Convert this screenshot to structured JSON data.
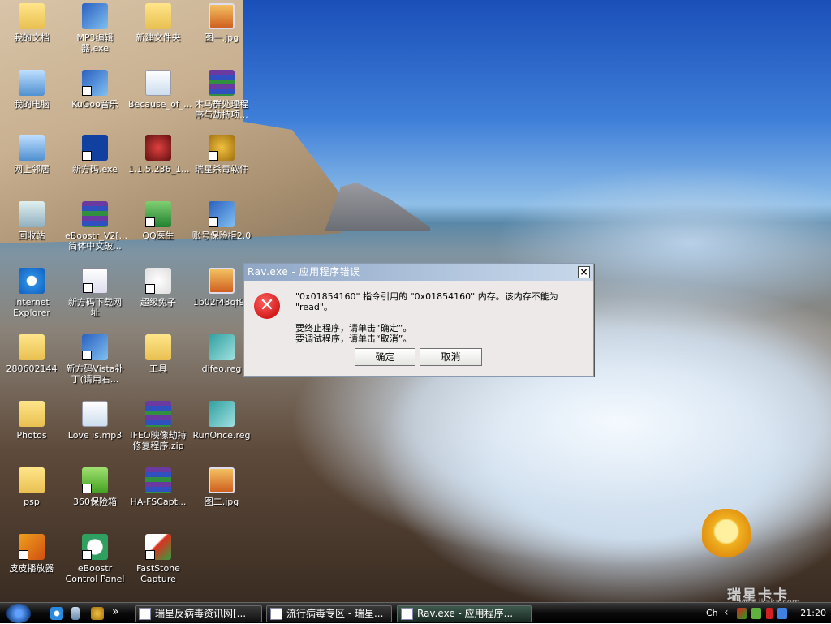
{
  "desktop": {
    "icons": [
      {
        "label": "我的文档",
        "kind": "folder"
      },
      {
        "label": "MP3编辑器.exe",
        "kind": "app"
      },
      {
        "label": "新建文件夹",
        "kind": "folder"
      },
      {
        "label": "图一.jpg",
        "kind": "img"
      },
      {
        "label": "我的电脑",
        "kind": "pc"
      },
      {
        "label": "KuGoo音乐",
        "kind": "app",
        "shortcut": true
      },
      {
        "label": "Because_of_...",
        "kind": "mp3"
      },
      {
        "label": "木马群处理程序与劫持项...",
        "kind": "rar"
      },
      {
        "label": "网上邻居",
        "kind": "pc"
      },
      {
        "label": "新方码.exe",
        "kind": "star",
        "shortcut": true
      },
      {
        "label": "1.1.5.236_1...",
        "kind": "qq"
      },
      {
        "label": "瑞星杀毒软件",
        "kind": "lionico",
        "shortcut": true
      },
      {
        "label": "回收站",
        "kind": "bin"
      },
      {
        "label": "eBoostr_V2[...简体中文破...",
        "kind": "rar"
      },
      {
        "label": "QQ医生",
        "kind": "shield",
        "shortcut": true
      },
      {
        "label": "账号保险柜2.0",
        "kind": "app",
        "shortcut": true
      },
      {
        "label": "Internet Explorer",
        "kind": "ie"
      },
      {
        "label": "新方码下载网址",
        "kind": "doc",
        "shortcut": true
      },
      {
        "label": "超级兔子",
        "kind": "rabbit",
        "shortcut": true
      },
      {
        "label": "1b02f43qf9a",
        "kind": "img"
      },
      {
        "label": "280602144",
        "kind": "folder"
      },
      {
        "label": "新方码Vista补丁(请用右...",
        "kind": "app",
        "shortcut": true
      },
      {
        "label": "工具",
        "kind": "folder"
      },
      {
        "label": "difeo.reg",
        "kind": "reg"
      },
      {
        "label": "Photos",
        "kind": "folder"
      },
      {
        "label": "Love is.mp3",
        "kind": "mp3"
      },
      {
        "label": "IFEO映像劫持修复程序.zip",
        "kind": "rar"
      },
      {
        "label": "RunOnce.reg",
        "kind": "reg"
      },
      {
        "label": "psp",
        "kind": "folder"
      },
      {
        "label": "360保险箱",
        "kind": "safe",
        "shortcut": true
      },
      {
        "label": "HA-FSCapt...",
        "kind": "rar"
      },
      {
        "label": "图二.jpg",
        "kind": "img"
      },
      {
        "label": "皮皮播放器",
        "kind": "player",
        "shortcut": true
      },
      {
        "label": "eBoostr Control Panel",
        "kind": "gauge",
        "shortcut": true
      },
      {
        "label": "FastStone Capture",
        "kind": "fast",
        "shortcut": true
      }
    ]
  },
  "dialog": {
    "title": "Rav.exe - 应用程序错误",
    "close": "×",
    "icon": "error-icon",
    "message": "\"0x01854160\" 指令引用的 \"0x01854160\" 内存。该内存不能为 \"read\"。",
    "line2": "要终止程序，请单击“确定”。",
    "line3": "要调试程序，请单击“取消”。",
    "ok": "确定",
    "cancel": "取消"
  },
  "taskbar": {
    "chevron": "»",
    "tasks": [
      {
        "label": "瑞星反病毒资讯网[..."
      },
      {
        "label": "流行病毒专区 - 瑞星..."
      },
      {
        "label": "Rav.exe - 应用程序..."
      }
    ],
    "tray": {
      "lang": "Ch",
      "expand": "‹",
      "time": "21:20"
    }
  },
  "watermark": {
    "brand": "瑞星卡卡",
    "url": "www.ikaka.com"
  }
}
